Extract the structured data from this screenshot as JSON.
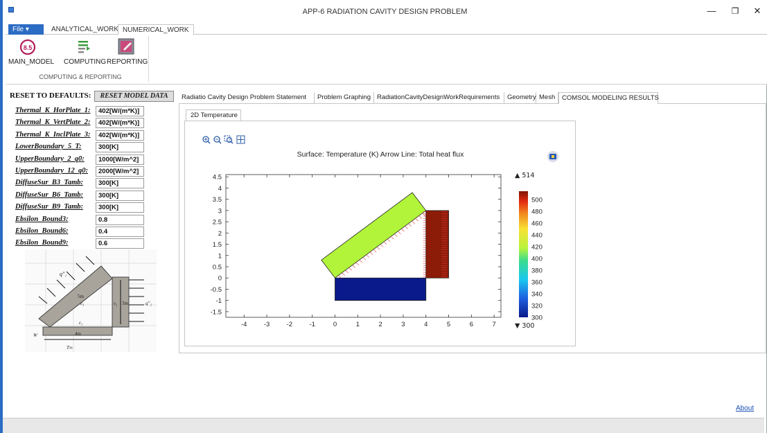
{
  "window": {
    "title": "APP-6 RADIATION CAVITY DESIGN PROBLEM",
    "minimize": "—",
    "restore": "❐",
    "close": "✕"
  },
  "ribbon": {
    "file_label": "File ▾",
    "tabs": [
      "ANALYTICAL_WORK",
      "NUMERICAL_WORK"
    ],
    "buttons": [
      {
        "label": "MAIN_MODEL",
        "icon": "main-model-icon",
        "badge": "8.5"
      },
      {
        "label": "COMPUTING",
        "icon": "computing-icon"
      },
      {
        "label": "REPORTING",
        "icon": "reporting-icon"
      }
    ],
    "group_label": "COMPUTING & REPORTING"
  },
  "params": {
    "reset_label": "RESET TO DEFAULTS:",
    "reset_button": "RESET MODEL DATA",
    "rows": [
      {
        "label": "Thermal_K_HorPlate_1:",
        "value": "402[W/(m*K)]"
      },
      {
        "label": "Thermal_K_VertPlate_2:",
        "value": "402[W/(m*K)]"
      },
      {
        "label": "Thermal_K_InclPlate_3:",
        "value": "402[W/(m*K)]"
      },
      {
        "label": "LowerBoundary_5_T:",
        "value": "300[K]"
      },
      {
        "label": "UpperBoundary_2_q0:",
        "value": "1000[W/m^2]"
      },
      {
        "label": "UpperBoundary_12_q0:",
        "value": "2000[W/m^2]"
      },
      {
        "label": "DiffuseSur_B3_Tamb:",
        "value": "300[K]"
      },
      {
        "label": "DiffuseSur_B6_Tamb:",
        "value": "300[K]"
      },
      {
        "label": "DiffuseSur_B9_Tamb:",
        "value": "300[K]"
      },
      {
        "label": "Ebsilon_Bound3:",
        "value": "0.8"
      },
      {
        "label": "Ebsilon_Bound6:",
        "value": "0.4"
      },
      {
        "label": "Ebsilon_Bound9:",
        "value": "0.6"
      }
    ]
  },
  "sketch": {
    "labels": [
      "q\"₁",
      "5m",
      "ε₃",
      "ε₂",
      "3m",
      "q\"₂",
      "ε₁",
      "4m",
      "W",
      "T∞"
    ]
  },
  "main_tabs": [
    "Radiatio Cavity Design Problem Statement",
    "Problem Graphing",
    "RadiationCavityDesignWorkRequirements",
    "Geometry",
    "Mesh",
    "COMSOL MODELING RESULTS"
  ],
  "sub_tab": "2D Temperature",
  "colors": {
    "accent": "#2b6cc4",
    "horizontal_plate": "#0a1a8a",
    "vertical_plate": "#8c1b07",
    "inclined_plate": "#b1f43a"
  },
  "chart_data": {
    "type": "heatmap",
    "title": "Surface: Temperature (K)  Arrow Line: Total heat flux",
    "x_ticks": [
      "-4",
      "-3",
      "-2",
      "-1",
      "0",
      "1",
      "2",
      "3",
      "4",
      "5",
      "6",
      "7"
    ],
    "y_ticks": [
      "4.5",
      "4",
      "3.5",
      "3",
      "2.5",
      "2",
      "1.5",
      "1",
      "0.5",
      "0",
      "-0.5",
      "-1",
      "-1.5"
    ],
    "xlim": [
      -4.8,
      7.3
    ],
    "ylim": [
      -1.75,
      4.6
    ],
    "colorbar": {
      "max_label": "▲ 514",
      "min_label": "▼ 300",
      "ticks": [
        "500",
        "480",
        "460",
        "440",
        "420",
        "400",
        "380",
        "360",
        "340",
        "320",
        "300"
      ],
      "range": [
        300,
        514
      ]
    },
    "regions": [
      {
        "name": "horizontal-plate",
        "shape": "rect",
        "x": [
          0,
          4
        ],
        "y": [
          -1,
          0
        ],
        "temperature": 300
      },
      {
        "name": "vertical-plate",
        "shape": "rect",
        "x": [
          4,
          5
        ],
        "y": [
          0,
          3
        ],
        "temperature": 514
      },
      {
        "name": "inclined-plate",
        "shape": "polygon",
        "points": [
          [
            0,
            0
          ],
          [
            4,
            3
          ],
          [
            3.4,
            3.8
          ],
          [
            -0.6,
            0.8
          ]
        ],
        "temperature": 420
      }
    ]
  },
  "about_link": "About"
}
